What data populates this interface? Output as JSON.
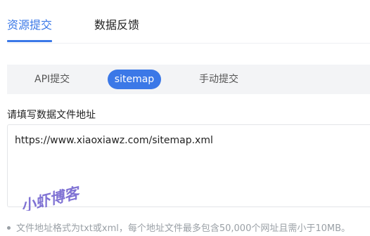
{
  "tabs": {
    "active_label": "资源提交",
    "inactive_label": "数据反馈"
  },
  "subtabs": {
    "api_label": "API提交",
    "sitemap_label": "sitemap",
    "manual_label": "手动提交"
  },
  "form": {
    "field_label": "请填写数据文件地址",
    "url_value": "https://www.xiaoxiawz.com/sitemap.xml"
  },
  "watermark": {
    "text": "小虾博客"
  },
  "hint": {
    "text": "文件地址格式为txt或xml，每个地址文件最多包含50,000个网址且需小于10MB。"
  },
  "colors": {
    "accent": "#3b78e7",
    "watermark": "#6a5acd",
    "hint": "#9aa0a6"
  }
}
